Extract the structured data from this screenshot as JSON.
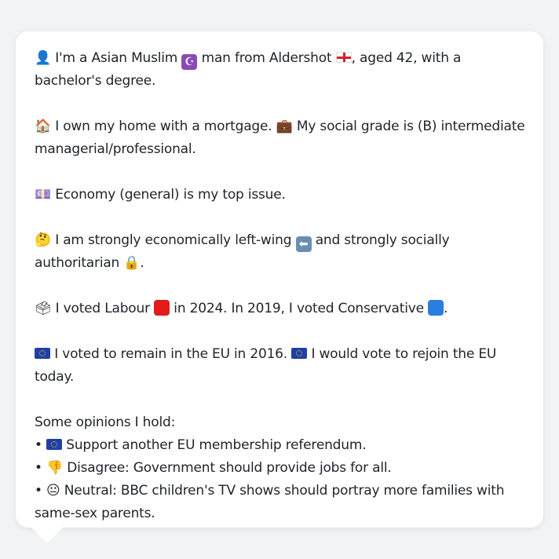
{
  "profile": {
    "line1_a": "I'm a Asian Muslim",
    "line1_b": "man from Aldershot",
    "line1_c": ", aged 42, with a bachelor's degree.",
    "line2_a": "I own my home with a mortgage.",
    "line2_b": "My social grade is (B) intermediate managerial/professional.",
    "line3": "Economy (general) is my top issue.",
    "line4_a": "I am strongly economically left-wing",
    "line4_b": "and strongly socially authoritarian",
    "line4_c": ".",
    "line5_a": "I voted Labour",
    "line5_b": "in 2024. In 2019, I voted Conservative",
    "line5_c": ".",
    "line6_a": "I voted to remain in the EU in 2016.",
    "line6_b": "I would vote to rejoin the EU today."
  },
  "opinions": {
    "heading": "Some opinions I hold:",
    "items": [
      "Support another EU membership referendum.",
      "Disagree: Government should provide jobs for all.",
      "Neutral: BBC children's TV shows should portray more families with same-sex parents."
    ]
  },
  "icons": {
    "person": "bust-in-silhouette-icon",
    "crescent": "star-and-crescent-icon",
    "england": "england-flag-icon",
    "house": "house-icon",
    "briefcase": "briefcase-icon",
    "money": "money-icon",
    "thinking": "thinking-face-icon",
    "left": "left-arrow-icon",
    "lock": "lock-icon",
    "ballot": "ballot-box-icon",
    "labour": "red-square-icon",
    "conservative": "blue-square-icon",
    "eu": "eu-flag-icon",
    "thumbs_down": "thumbs-down-icon",
    "neutral": "neutral-face-icon"
  },
  "colors": {
    "background": "#f2f3f5",
    "card": "#ffffff",
    "text": "#1f2328",
    "labour_red": "#e21b1b",
    "conservative_blue": "#2a7de1",
    "eu_blue": "#1f3fa8"
  }
}
